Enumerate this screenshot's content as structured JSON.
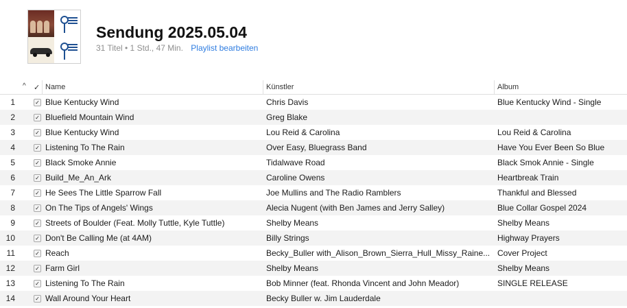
{
  "playlist": {
    "title": "Sendung 2025.05.04",
    "summary": "31 Titel • 1 Std., 47 Min.",
    "edit_label": "Playlist bearbeiten"
  },
  "columns": {
    "sort_glyph": "^",
    "check_glyph": "✓",
    "name": "Name",
    "artist": "Künstler",
    "album": "Album"
  },
  "tracks": [
    {
      "num": "1",
      "checked": true,
      "name": "Blue Kentucky Wind",
      "artist": "Chris Davis",
      "album": "Blue Kentucky Wind - Single"
    },
    {
      "num": "2",
      "checked": true,
      "name": "Bluefield Mountain Wind",
      "artist": "Greg Blake",
      "album": ""
    },
    {
      "num": "3",
      "checked": true,
      "name": "Blue Kentucky Wind",
      "artist": "Lou Reid & Carolina",
      "album": "Lou Reid & Carolina"
    },
    {
      "num": "4",
      "checked": true,
      "name": "Listening To The Rain",
      "artist": "Over Easy, Bluegrass Band",
      "album": "Have You Ever Been So Blue"
    },
    {
      "num": "5",
      "checked": true,
      "name": "Black Smoke Annie",
      "artist": "Tidalwave Road",
      "album": "Black Smok Annie - Single"
    },
    {
      "num": "6",
      "checked": true,
      "name": "Build_Me_An_Ark",
      "artist": "Caroline Owens",
      "album": "Heartbreak Train"
    },
    {
      "num": "7",
      "checked": true,
      "name": "He Sees The Little Sparrow Fall",
      "artist": "Joe Mullins and The Radio Ramblers",
      "album": "Thankful and Blessed"
    },
    {
      "num": "8",
      "checked": true,
      "name": "On The Tips of Angels' Wings",
      "artist": "Alecia Nugent (with Ben James and Jerry Salley)",
      "album": "Blue Collar Gospel 2024"
    },
    {
      "num": "9",
      "checked": true,
      "name": "Streets of Boulder (Feat. Molly Tuttle, Kyle Tuttle)",
      "artist": "Shelby Means",
      "album": "Shelby Means"
    },
    {
      "num": "10",
      "checked": true,
      "name": "Don't Be Calling Me (at 4AM)",
      "artist": "Billy Strings",
      "album": "Highway Prayers"
    },
    {
      "num": "11",
      "checked": true,
      "name": "Reach",
      "artist": "Becky_Buller with_Alison_Brown_Sierra_Hull_Missy_Raine...",
      "album": "Cover Project"
    },
    {
      "num": "12",
      "checked": true,
      "name": "Farm Girl",
      "artist": "Shelby Means",
      "album": "Shelby Means"
    },
    {
      "num": "13",
      "checked": true,
      "name": "Listening To The Rain",
      "artist": "Bob Minner (feat. Rhonda Vincent and John Meador)",
      "album": "SINGLE RELEASE"
    },
    {
      "num": "14",
      "checked": true,
      "name": "Wall Around Your Heart",
      "artist": "Becky Buller w. Jim Lauderdale",
      "album": ""
    }
  ],
  "colors": {
    "link": "#2e7ce0",
    "row_alt": "#f3f3f3",
    "meta_text": "#8e8e8e"
  },
  "icons": [
    "playlist-artwork-mosaic",
    "sort-indicator-icon",
    "checkbox-icon"
  ]
}
